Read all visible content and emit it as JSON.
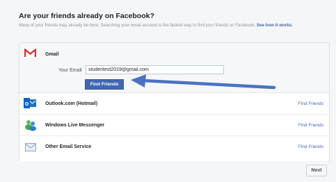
{
  "header": {
    "title": "Are your friends already on Facebook?",
    "subtitle": "Many of your friends may already be here. Searching your email account is the fastest way to find your friends on Facebook.",
    "see_how_link": "See how it works."
  },
  "gmail": {
    "provider_name": "Gmail",
    "email_label": "Your Email",
    "email_value": "studentest2019@gmail.com",
    "find_button": "Find Friends"
  },
  "providers": [
    {
      "name": "Outlook.com (Hotmail)",
      "link": "Find Friends",
      "icon": "outlook-icon"
    },
    {
      "name": "Windows Live Messenger",
      "link": "Find Friends",
      "icon": "windows-live-messenger-icon"
    },
    {
      "name": "Other Email Service",
      "link": "Find Friends",
      "icon": "envelope-icon"
    }
  ],
  "footer": {
    "next_label": "Next"
  },
  "colors": {
    "facebook_blue": "#4267b2",
    "annotation_arrow": "#4a72c4",
    "gmail_red": "#d93025"
  }
}
